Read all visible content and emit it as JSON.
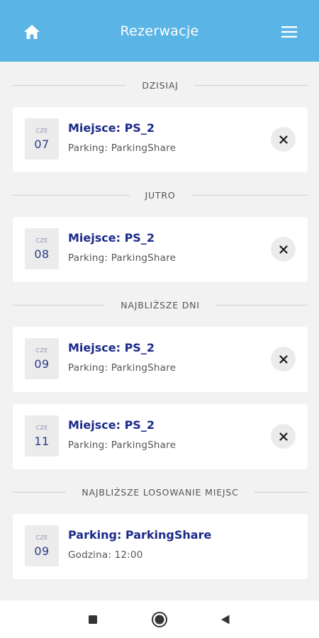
{
  "header": {
    "title": "Rezerwacje"
  },
  "sections": {
    "today": "DZISIAJ",
    "tomorrow": "JUTRO",
    "upcoming": "NAJBLIŻSZE DNI",
    "lottery": "NAJBLIŻSZE LOSOWANIE MIEJSC"
  },
  "reservations": [
    {
      "dow": "CZE",
      "day": "07",
      "spot": "Miejsce: PS_2",
      "parking": "Parking: ParkingShare"
    },
    {
      "dow": "CZE",
      "day": "08",
      "spot": "Miejsce: PS_2",
      "parking": "Parking: ParkingShare"
    },
    {
      "dow": "CZE",
      "day": "09",
      "spot": "Miejsce: PS_2",
      "parking": "Parking: ParkingShare"
    },
    {
      "dow": "CZE",
      "day": "11",
      "spot": "Miejsce: PS_2",
      "parking": "Parking: ParkingShare"
    }
  ],
  "lottery": {
    "dow": "CZE",
    "day": "09",
    "parking": "Parking: ParkingShare",
    "time": "Godzina: 12:00"
  },
  "icons": {
    "home": "home-icon",
    "menu": "hamburger-menu-icon",
    "cancel": "close-icon",
    "nav_recents": "square-icon",
    "nav_home": "circle-icon",
    "nav_back": "triangle-back-icon"
  },
  "colors": {
    "app_bar": "#5ab4e6",
    "primary_text": "#1b2a8a",
    "background": "#f2f2f2"
  }
}
